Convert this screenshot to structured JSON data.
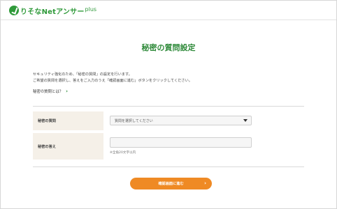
{
  "header": {
    "logo_text": "りそなNetアンサー",
    "logo_plus": "plus"
  },
  "page": {
    "title": "秘密の質問設定"
  },
  "intro": {
    "line1": "セキュリティ強化のため、「秘密の質問」の設定を行います。",
    "line2": "ご希望の質問を選択し、答えをご入力のうえ「確認画面に進む」ボタンをクリックしてください。"
  },
  "help": {
    "label": "秘密の質問とは？",
    "icon": "chevron-right-icon"
  },
  "form": {
    "question": {
      "label": "秘密の質問",
      "placeholder": "質問を選択してください"
    },
    "answer": {
      "label": "秘密の答え",
      "value": "",
      "note": "※全角20文字以内"
    }
  },
  "actions": {
    "submit_label": "確認画面に進む"
  },
  "colors": {
    "brand_green": "#2f8a3a",
    "accent_orange": "#ef8a24",
    "label_bg": "#f5f0e8"
  }
}
